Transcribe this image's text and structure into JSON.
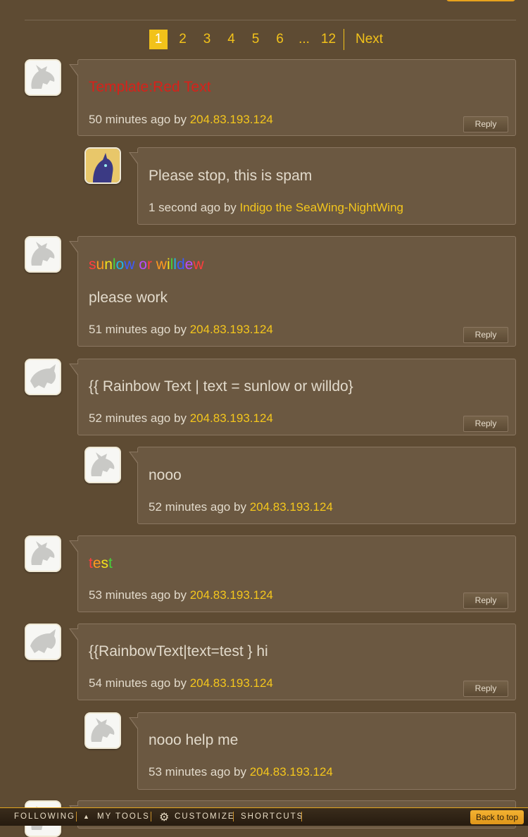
{
  "pagination": {
    "pages": [
      "1",
      "2",
      "3",
      "4",
      "5",
      "6"
    ],
    "ellipsis": "...",
    "last_page": "12",
    "next_label": "Next",
    "current": "1"
  },
  "comments": [
    {
      "text": "Template:Red Text",
      "time": "50 minutes ago",
      "by": "by",
      "author": "204.83.193.124",
      "reply": "Reply"
    },
    {
      "text": "Please stop, this is spam",
      "time": "1 second ago",
      "by": "by",
      "author": "Indigo the SeaWing-NightWing"
    },
    {
      "text": "sunlow or willdew",
      "text2": "please work",
      "time": "51 minutes ago",
      "by": "by",
      "author": "204.83.193.124",
      "reply": "Reply"
    },
    {
      "text": "{{ Rainbow Text | text = sunlow or willdo}",
      "time": "52 minutes ago",
      "by": "by",
      "author": "204.83.193.124",
      "reply": "Reply"
    },
    {
      "text": "nooo",
      "time": "52 minutes ago",
      "by": "by",
      "author": "204.83.193.124"
    },
    {
      "text": "test",
      "time": "53 minutes ago",
      "by": "by",
      "author": "204.83.193.124",
      "reply": "Reply"
    },
    {
      "text": "{{RainbowText|text=test } hi",
      "time": "54 minutes ago",
      "by": "by",
      "author": "204.83.193.124",
      "reply": "Reply"
    },
    {
      "text": "nooo help me",
      "time": "53 minutes ago",
      "by": "by",
      "author": "204.83.193.124"
    }
  ],
  "rainbow_colors": [
    "#ff3d3d",
    "#ff9a1f",
    "#f4e21c",
    "#46d13a",
    "#1fb8e8",
    "#3b5bff",
    "#b94cff"
  ],
  "colors": {
    "accent": "#f4c61c",
    "background": "#5e4b33",
    "bubble": "#6b5841"
  },
  "toolbar": {
    "following": "FOLLOWING",
    "my_tools": "MY TOOLS",
    "customize": "CUSTOMIZE",
    "shortcuts": "SHORTCUTS",
    "back_to_top": "Back to top"
  }
}
